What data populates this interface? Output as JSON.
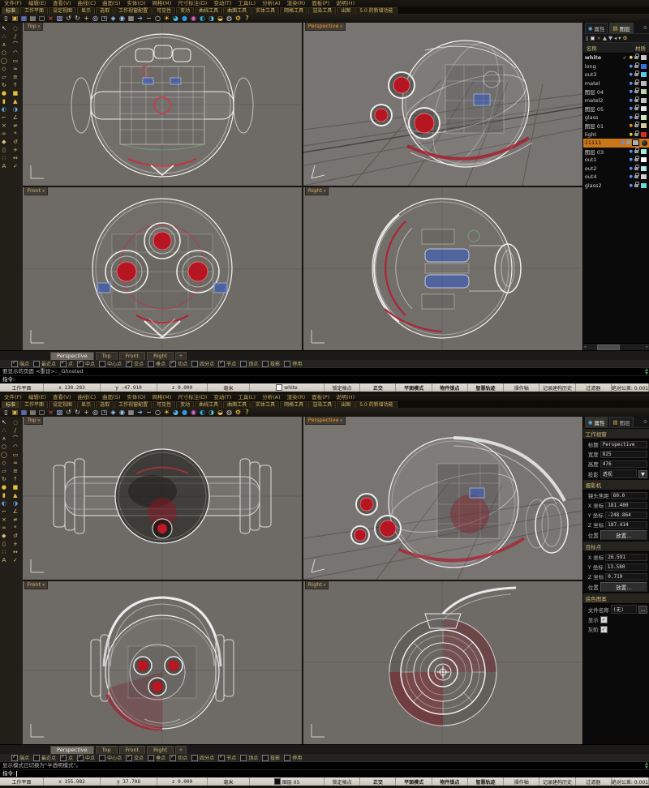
{
  "app": {
    "menu": [
      "文件(F)",
      "编辑(E)",
      "查看(V)",
      "曲线(C)",
      "曲面(S)",
      "实体(O)",
      "网格(M)",
      "尺寸标注(D)",
      "变动(T)",
      "工具(L)",
      "分析(A)",
      "渲染(R)",
      "面板(P)",
      "说明(H)"
    ],
    "toolbar_tabs": [
      {
        "label": "标准",
        "active": true
      },
      {
        "label": "工作平面"
      },
      {
        "label": "设定视图"
      },
      {
        "label": "显示"
      },
      {
        "label": "选取"
      },
      {
        "label": "工作视窗配置"
      },
      {
        "label": "可见性"
      },
      {
        "label": "变动"
      },
      {
        "label": "曲线工具"
      },
      {
        "label": "曲面工具"
      },
      {
        "label": "实体工具"
      },
      {
        "label": "网格工具"
      },
      {
        "label": "渲染工具"
      },
      {
        "label": "出图"
      },
      {
        "label": "5.0 的新增功能"
      }
    ],
    "top_icons": [
      {
        "name": "new-file-icon",
        "glyph": "▯",
        "color": "#e9e9e9"
      },
      {
        "name": "open-folder-icon",
        "glyph": "▣",
        "color": "#d8b24a"
      },
      {
        "name": "save-icon",
        "glyph": "▦",
        "color": "#7a8ef0"
      },
      {
        "name": "print-icon",
        "glyph": "▤",
        "color": "#cfcfcf"
      },
      {
        "name": "copy-icon",
        "glyph": "▢",
        "color": "#cfcfcf"
      },
      {
        "name": "delete-icon",
        "glyph": "×",
        "color": "#e05050"
      },
      {
        "name": "paste-icon",
        "glyph": "▧",
        "color": "#b0c4ff"
      },
      {
        "name": "undo-icon",
        "glyph": "↺",
        "color": "#cfcfcf"
      },
      {
        "name": "rotate-view-icon",
        "glyph": "↻",
        "color": "#cfcfcf"
      },
      {
        "name": "pan-icon",
        "glyph": "+",
        "color": "#e0d0a0"
      },
      {
        "name": "zoom-icon",
        "glyph": "◎",
        "color": "#cfe0ff"
      },
      {
        "name": "zoom-window-icon",
        "glyph": "◳",
        "color": "#cfe0ff"
      },
      {
        "name": "zoom-extents-icon",
        "glyph": "◈",
        "color": "#9ad0ff"
      },
      {
        "name": "zoom-selected-icon",
        "glyph": "◉",
        "color": "#9ad0ff"
      },
      {
        "name": "grid-icon",
        "glyph": "▦",
        "color": "#b8b8b8"
      },
      {
        "name": "move-icon",
        "glyph": "➔",
        "color": "#8ab4ff"
      },
      {
        "name": "curve-icon",
        "glyph": "~",
        "color": "#e8e8e8"
      },
      {
        "name": "circle-icon",
        "glyph": "○",
        "color": "#e8e8e8"
      },
      {
        "name": "light-icon",
        "glyph": "☀",
        "color": "#ffd84a"
      },
      {
        "name": "material-icon",
        "glyph": "◕",
        "color": "#49c0e8"
      },
      {
        "name": "render-icon",
        "glyph": "●",
        "color": "#2e9ae0"
      },
      {
        "name": "color-wheel-icon",
        "glyph": "◉",
        "color": "#e06ad0"
      },
      {
        "name": "shaded-mode-icon",
        "glyph": "◐",
        "color": "#30b0e8"
      },
      {
        "name": "ghosted-mode-icon",
        "glyph": "◑",
        "color": "#58c8d8"
      },
      {
        "name": "xray-mode-icon",
        "glyph": "◒",
        "color": "#e8b848"
      },
      {
        "name": "wireframe-mode-icon",
        "glyph": "◍",
        "color": "#d0d0d0"
      },
      {
        "name": "settings-icon",
        "glyph": "⚙",
        "color": "#ffcf40"
      },
      {
        "name": "help-icon",
        "glyph": "?",
        "color": "#ffd84a"
      }
    ],
    "left_icons": [
      {
        "name": "pointer-icon",
        "glyph": "↖",
        "color": "#e8e8e8"
      },
      {
        "name": "lasso-icon",
        "glyph": "◌",
        "color": "#d8c080"
      },
      {
        "name": "point-icon",
        "glyph": "∴",
        "color": "#d8c080"
      },
      {
        "name": "line-icon",
        "glyph": "/",
        "color": "#d8c080"
      },
      {
        "name": "polyline-icon",
        "glyph": "∧",
        "color": "#d8c080"
      },
      {
        "name": "curve-icon",
        "glyph": "⌒",
        "color": "#d8c080"
      },
      {
        "name": "circle-icon",
        "glyph": "○",
        "color": "#d8c080"
      },
      {
        "name": "arc-icon",
        "glyph": "◠",
        "color": "#d8c080"
      },
      {
        "name": "ellipse-icon",
        "glyph": "◯",
        "color": "#d8c080"
      },
      {
        "name": "rectangle-icon",
        "glyph": "▭",
        "color": "#d8c080"
      },
      {
        "name": "polygon-icon",
        "glyph": "◇",
        "color": "#d8c080"
      },
      {
        "name": "freeform-icon",
        "glyph": "≈",
        "color": "#d8c080"
      },
      {
        "name": "surface-icon",
        "glyph": "▱",
        "color": "#d8c080"
      },
      {
        "name": "loft-icon",
        "glyph": "≡",
        "color": "#d8c080"
      },
      {
        "name": "revolve-icon",
        "glyph": "↻",
        "color": "#d8c080"
      },
      {
        "name": "extrude-icon",
        "glyph": "↑",
        "color": "#d8c080"
      },
      {
        "name": "sphere-icon",
        "glyph": "●",
        "color": "#e8c040"
      },
      {
        "name": "box-icon",
        "glyph": "■",
        "color": "#e8c040"
      },
      {
        "name": "cylinder-icon",
        "glyph": "▮",
        "color": "#e8c040"
      },
      {
        "name": "cone-icon",
        "glyph": "▲",
        "color": "#e8c040"
      },
      {
        "name": "boolean-union-icon",
        "glyph": "◐",
        "color": "#6aa0e8"
      },
      {
        "name": "boolean-difference-icon",
        "glyph": "◑",
        "color": "#6aa0e8"
      },
      {
        "name": "fillet-icon",
        "glyph": "⌐",
        "color": "#d8c080"
      },
      {
        "name": "chamfer-icon",
        "glyph": "∠",
        "color": "#d8c080"
      },
      {
        "name": "trim-icon",
        "glyph": "×",
        "color": "#d8c080"
      },
      {
        "name": "split-icon",
        "glyph": "≠",
        "color": "#d8c080"
      },
      {
        "name": "join-icon",
        "glyph": "∞",
        "color": "#d8c080"
      },
      {
        "name": "explode-icon",
        "glyph": "*",
        "color": "#d8c080"
      },
      {
        "name": "scale-icon",
        "glyph": "◆",
        "color": "#d8c080"
      },
      {
        "name": "rotate-icon",
        "glyph": "↺",
        "color": "#d8c080"
      },
      {
        "name": "mirror-icon",
        "glyph": "▯",
        "color": "#d8c080"
      },
      {
        "name": "move-icon",
        "glyph": "+",
        "color": "#d8c080"
      },
      {
        "name": "array-icon",
        "glyph": "∷",
        "color": "#d8c080"
      },
      {
        "name": "dimension-icon",
        "glyph": "↔",
        "color": "#d8c080"
      },
      {
        "name": "text-icon",
        "glyph": "A",
        "color": "#d8c080"
      },
      {
        "name": "visibility-icon",
        "glyph": "✓",
        "color": "#d8c080"
      }
    ],
    "viewport_labels": {
      "top": "Top",
      "perspective": "Perspective",
      "front": "Front",
      "right": "Right"
    },
    "viewport_dd": "▾",
    "vtabs": [
      {
        "label": "Perspective",
        "active": true
      },
      {
        "label": "Top"
      },
      {
        "label": "Front"
      },
      {
        "label": "Right"
      }
    ],
    "vtab_new": "+",
    "osnap": [
      {
        "label": "端点",
        "checked": true
      },
      {
        "label": "最近点",
        "checked": false
      },
      {
        "label": "点",
        "checked": true
      },
      {
        "label": "中点",
        "checked": true
      },
      {
        "label": "中心点",
        "checked": false
      },
      {
        "label": "交点",
        "checked": true
      },
      {
        "label": "垂点",
        "checked": false
      },
      {
        "label": "切点",
        "checked": true
      },
      {
        "label": "四分点",
        "checked": false
      },
      {
        "label": "节点",
        "checked": true
      },
      {
        "label": "顶点",
        "checked": false
      },
      {
        "label": "投影",
        "checked": false
      },
      {
        "label": "停用",
        "checked": false
      }
    ],
    "status": {
      "plane": "工作平面",
      "units": "毫米",
      "toggles": [
        {
          "label": "锁定格点"
        },
        {
          "label": "正交",
          "bold": true
        },
        {
          "label": "平面模式",
          "bold": true
        },
        {
          "label": "物件锁点",
          "bold": true
        },
        {
          "label": "智慧轨迹",
          "bold": true
        },
        {
          "label": "操作轴"
        },
        {
          "label": "记录建构历史"
        },
        {
          "label": "过滤器"
        },
        {
          "label": "绝对公差: 0.001"
        }
      ]
    },
    "glyphs": {
      "left": "◂",
      "right": "▸",
      "up": "▲",
      "down": "▼",
      "gear": "⚙",
      "panel_props_icon": "◉",
      "panel_layers_icon": "▤"
    }
  },
  "window1": {
    "history": "要显示的页面 <重设>: _Ghosted",
    "prompt": "指令:",
    "status": {
      "x": "x 130.283",
      "y": "y -47.910",
      "z": "z 0.000",
      "layer": "white",
      "layer_color": "#f8f8f8"
    },
    "panel": {
      "tab_properties": "属性",
      "tab_layers": "图层",
      "head_name": "名称",
      "head_material": "材质",
      "toolbar": [
        {
          "name": "new-layer-icon",
          "glyph": "▯",
          "color": "#ddd"
        },
        {
          "name": "new-sublayer-icon",
          "glyph": "▣",
          "color": "#ddd"
        },
        {
          "name": "delete-layer-icon",
          "glyph": "×",
          "color": "#e06060"
        },
        {
          "name": "move-up-icon",
          "glyph": "▲",
          "color": "#bbb"
        },
        {
          "name": "move-down-icon",
          "glyph": "▼",
          "color": "#bbb"
        },
        {
          "name": "collapse-icon",
          "glyph": "◂",
          "color": "#bbb"
        },
        {
          "name": "filter-icon",
          "glyph": "▾",
          "color": "#d8c060"
        },
        {
          "name": "layer-tools-icon",
          "glyph": "⚙",
          "color": "#d8c060"
        }
      ],
      "layers": [
        {
          "name": "white",
          "check": "✓",
          "weight": "bold",
          "bulb": "#f0d060",
          "color": "#c8c8c8"
        },
        {
          "name": "long",
          "bulb": "#5890f0",
          "color": "#3a6fd8"
        },
        {
          "name": "out3",
          "bulb": "#5890f0",
          "color": "#58d0e8"
        },
        {
          "name": "matel",
          "bulb": "#5890f0",
          "color": "#b8b8b8"
        },
        {
          "name": "图层 04",
          "bulb": "#5890f0",
          "color": "#b8d8a8"
        },
        {
          "name": "matel2",
          "bulb": "#5890f0",
          "color": "#c4c4c4"
        },
        {
          "name": "图层 05",
          "bulb": "#5890f0",
          "color": "#e6e6e6"
        },
        {
          "name": "glass",
          "bulb": "#5890f0",
          "color": "#cfe8c0"
        },
        {
          "name": "图层 01",
          "bulb": "#e89020",
          "color": "#d8c8a0"
        },
        {
          "name": "light",
          "bulb": "#e8d020",
          "color": "#e02828"
        },
        {
          "name": "11111",
          "selected": true,
          "bulb": "#5890f0",
          "color": "#b0b0b0"
        },
        {
          "name": "图层 03",
          "bulb": "#5890f0",
          "color": "#a0ecdc"
        },
        {
          "name": "out1",
          "bulb": "#5890f0",
          "color": "#ffffff"
        },
        {
          "name": "out2",
          "bulb": "#5890f0",
          "color": "#a8ecf0"
        },
        {
          "name": "out4",
          "bulb": "#5890f0",
          "color": "#d0d0d0"
        },
        {
          "name": "glass2",
          "bulb": "#5890f0",
          "color": "#60e0d8"
        }
      ]
    }
  },
  "window2": {
    "history": "显示模式已切换为\"半透明模式\"。",
    "prompt": "指令:",
    "status": {
      "x": "x 155.982",
      "y": "y 37.708",
      "z": "z 0.000",
      "layer": "图层 05",
      "layer_color": "#101010"
    },
    "panel": {
      "tab_properties": "属性",
      "tab_layers": "图层",
      "viewport": {
        "header": "工作视窗",
        "title_l": "标题",
        "title_v": "Perspective",
        "width_l": "宽度",
        "width_v": "825",
        "height_l": "高度",
        "height_v": "476",
        "proj_l": "投影",
        "proj_v": "透视"
      },
      "camera": {
        "header": "摄影机",
        "lens_l": "镜头焦距",
        "lens_v": "60.0",
        "x_l": "X 坐标",
        "x_v": "181.400",
        "y_l": "Y 坐标",
        "y_v": "-248.864",
        "z_l": "Z 坐标",
        "z_v": "187.414",
        "pos_l": "位置",
        "place_btn": "放置..."
      },
      "target": {
        "header": "目标点",
        "x_l": "X 坐标",
        "x_v": "26.591",
        "y_l": "Y 坐标",
        "y_v": "13.580",
        "z_l": "Z 坐标",
        "z_v": "0.719",
        "pos_l": "位置",
        "place_btn": "放置..."
      },
      "wallpaper": {
        "header": "底色图案",
        "file_l": "文件名称",
        "file_v": "(无)",
        "browse": "...",
        "show_l": "显示",
        "gray_l": "灰阶",
        "check": "✓"
      }
    }
  }
}
